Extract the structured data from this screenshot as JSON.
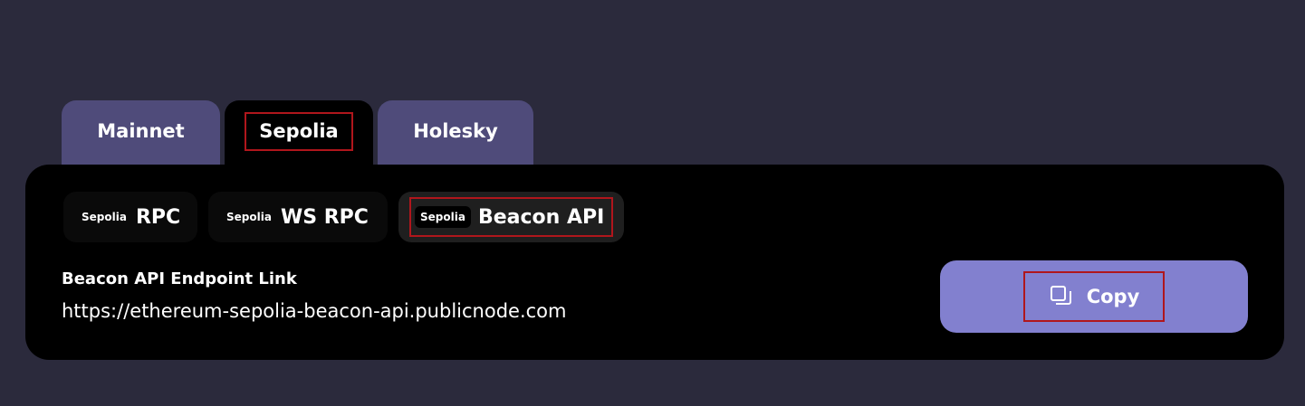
{
  "network_tabs": [
    {
      "label": "Mainnet",
      "active": false
    },
    {
      "label": "Sepolia",
      "active": true
    },
    {
      "label": "Holesky",
      "active": false
    }
  ],
  "endpoint_tabs": [
    {
      "network": "Sepolia",
      "label": "RPC",
      "active": false
    },
    {
      "network": "Sepolia",
      "label": "WS RPC",
      "active": false
    },
    {
      "network": "Sepolia",
      "label": "Beacon API",
      "active": true
    }
  ],
  "endpoint": {
    "title": "Beacon API Endpoint Link",
    "url": "https://ethereum-sepolia-beacon-api.publicnode.com"
  },
  "copy_button": {
    "label": "Copy",
    "icon": "copy-icon"
  },
  "colors": {
    "background": "#2b2a3c",
    "tab_inactive": "#4f4b7a",
    "card": "#000000",
    "button": "#8280cf",
    "highlight": "#b0161c"
  }
}
